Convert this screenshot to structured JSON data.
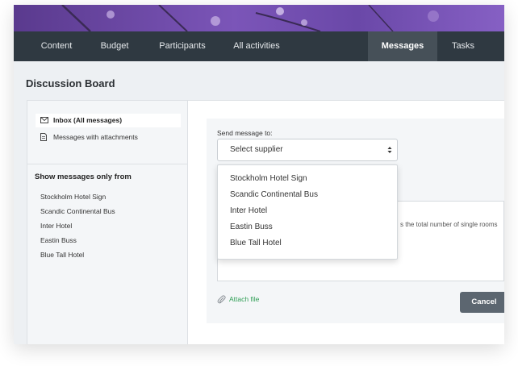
{
  "nav": {
    "tabs": [
      {
        "label": "Content"
      },
      {
        "label": "Budget"
      },
      {
        "label": "Participants"
      },
      {
        "label": "All activities"
      },
      {
        "label": "Messages",
        "active": true
      },
      {
        "label": "Tasks"
      }
    ]
  },
  "page": {
    "title": "Discussion Board"
  },
  "sidebar": {
    "items": [
      {
        "label": "Inbox (All messages)",
        "icon": "envelope-icon",
        "active": true
      },
      {
        "label": "Messages with attachments",
        "icon": "document-icon",
        "active": false
      }
    ],
    "filter_heading": "Show messages only from",
    "filters": [
      "Stockholm Hotel Sign",
      "Scandic Continental Bus",
      "Inter Hotel",
      "Eastin Buss",
      "Blue Tall Hotel"
    ]
  },
  "compose": {
    "send_to_label": "Send message to:",
    "select_value": "Select supplier",
    "message_fragment": "s the total number of single rooms",
    "attach_label": "Attach file",
    "cancel_label": "Cancel"
  },
  "dropdown": {
    "options": [
      "Stockholm Hotel Sign",
      "Scandic Continental Bus",
      "Inter Hotel",
      "Eastin Buss",
      "Blue Tall Hotel"
    ]
  },
  "colors": {
    "nav_bg": "#2f3941",
    "nav_active": "#465058",
    "accent_green": "#2f9e55",
    "banner_purple": "#6a48a8",
    "cancel_bg": "#5c6670"
  }
}
